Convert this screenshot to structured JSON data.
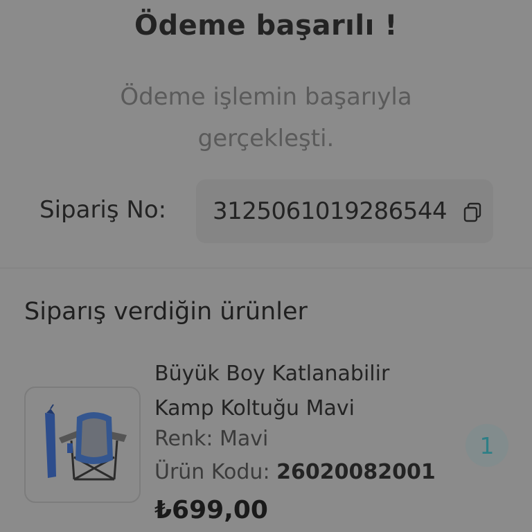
{
  "header": {
    "title": "Ödeme başarılı !",
    "message": "Ödeme işlemin başarıyla gerçekleşti."
  },
  "order": {
    "label": "Sipariş No:",
    "number": "3125061019286544",
    "copy_icon": "copy-icon"
  },
  "items_section": {
    "title": "Siparış verdiğin ürünler",
    "items": [
      {
        "name": "Büyük Boy Katlanabilir Kamp Koltuğu Mavi",
        "variant": "Renk: Mavi",
        "code_label": "Ürün Kodu:",
        "code": "26020082001",
        "price": "₺699,00",
        "quantity": "1",
        "image_icon": "camping-chair-image"
      }
    ]
  },
  "colors": {
    "accent": "#2e7f86",
    "overlay": "#8b8b8b",
    "text_dark": "#232323"
  }
}
